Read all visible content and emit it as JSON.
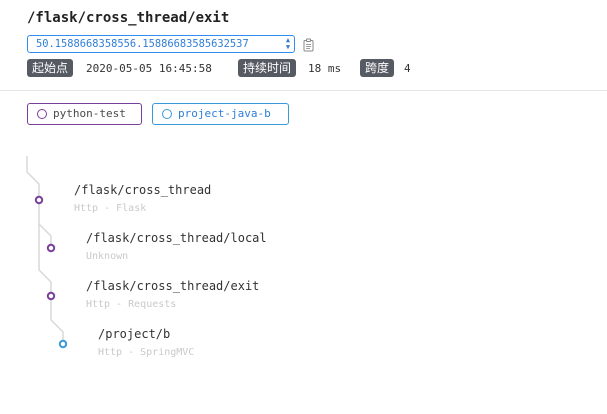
{
  "header": {
    "title": "/flask/cross_thread/exit",
    "trace_id": "50.1588668358556.15886683585632537"
  },
  "meta": {
    "start_label": "起始点",
    "start_value": "2020-05-05 16:45:58",
    "duration_label": "持续时间",
    "duration_value": "18 ms",
    "span_label": "跨度",
    "span_value": "4"
  },
  "services": [
    {
      "name": "python-test",
      "color": "#7a3f9d"
    },
    {
      "name": "project-java-b",
      "color": "#3a9ad9"
    }
  ],
  "spans": [
    {
      "endpoint": "/flask/cross_thread",
      "component": "Http - Flask",
      "service": "python-test"
    },
    {
      "endpoint": "/flask/cross_thread/local",
      "component": "Unknown",
      "service": "python-test"
    },
    {
      "endpoint": "/flask/cross_thread/exit",
      "component": "Http - Requests",
      "service": "python-test"
    },
    {
      "endpoint": "/project/b",
      "component": "Http - SpringMVC",
      "service": "project-java-b"
    }
  ]
}
